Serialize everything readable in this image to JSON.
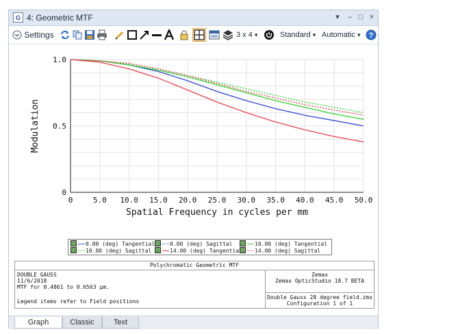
{
  "window": {
    "icon_letter": "G",
    "title": "4: Geometric MTF",
    "controls": {
      "menu": "▾",
      "minimize": "–",
      "restore": "□",
      "close": "×"
    }
  },
  "toolbar": {
    "settings_label": "Settings",
    "grid_label": "3 x 4",
    "standard_label": "Standard",
    "automatic_label": "Automatic",
    "dropdown_glyph": "▾"
  },
  "colors": {
    "blue": "#3b4fd6",
    "green": "#2fd12f",
    "red": "#e8414d",
    "accent": "#f2a33a"
  },
  "chart_data": {
    "type": "line",
    "xlabel": "Spatial Frequency in cycles per mm",
    "ylabel": "Modulation",
    "xlim": [
      0,
      50
    ],
    "ylim": [
      0,
      1.0
    ],
    "x_ticks": [
      "0",
      "5.0",
      "10.0",
      "15.0",
      "20.0",
      "25.0",
      "30.0",
      "35.0",
      "40.0",
      "45.0",
      "50.0"
    ],
    "y_ticks": [
      "0",
      "0.5",
      "1.0"
    ],
    "x": [
      0,
      5,
      10,
      15,
      20,
      25,
      30,
      35,
      40,
      45,
      50
    ],
    "series": [
      {
        "name": "0.00 (deg) Tangential",
        "color": "#3b4fd6",
        "dash": false,
        "values": [
          1.0,
          0.99,
          0.96,
          0.91,
          0.84,
          0.76,
          0.69,
          0.63,
          0.58,
          0.54,
          0.5
        ]
      },
      {
        "name": "0.00 (deg) Sagittal",
        "color": "#3b4fd6",
        "dash": true,
        "values": [
          1.0,
          0.99,
          0.96,
          0.91,
          0.84,
          0.76,
          0.69,
          0.63,
          0.58,
          0.54,
          0.5
        ]
      },
      {
        "name": "10.00 (deg) Tangential",
        "color": "#2fd12f",
        "dash": false,
        "values": [
          1.0,
          0.99,
          0.96,
          0.92,
          0.87,
          0.81,
          0.75,
          0.69,
          0.64,
          0.59,
          0.55
        ]
      },
      {
        "name": "10.00 (deg) Sagittal",
        "color": "#2fd12f",
        "dash": true,
        "values": [
          1.0,
          0.99,
          0.97,
          0.93,
          0.88,
          0.83,
          0.78,
          0.73,
          0.68,
          0.64,
          0.6
        ]
      },
      {
        "name": "14.00 (deg) Tangential",
        "color": "#e8414d",
        "dash": false,
        "values": [
          1.0,
          0.98,
          0.93,
          0.86,
          0.77,
          0.68,
          0.6,
          0.53,
          0.47,
          0.42,
          0.38
        ]
      },
      {
        "name": "14.00 (deg) Sagittal",
        "color": "#e8414d",
        "dash": true,
        "values": [
          1.0,
          0.99,
          0.97,
          0.93,
          0.88,
          0.82,
          0.76,
          0.71,
          0.66,
          0.62,
          0.58
        ]
      }
    ],
    "grid": true,
    "legend_position": "bottom"
  },
  "legend": {
    "items": [
      {
        "text": "0.00 (deg) Tangential",
        "color": "#3b4fd6",
        "dash": false
      },
      {
        "text": "0.00 (deg) Sagittal",
        "color": "#3b4fd6",
        "dash": true
      },
      {
        "text": "10.00 (deg) Tangential",
        "color": "#2fd12f",
        "dash": false
      },
      {
        "text": "10.00 (deg) Sagittal",
        "color": "#2fd12f",
        "dash": true
      },
      {
        "text": "14.00 (deg) Tangential",
        "color": "#e8414d",
        "dash": false
      },
      {
        "text": "14.00 (deg) Sagittal",
        "color": "#e8414d",
        "dash": true
      }
    ]
  },
  "info": {
    "header": "Polychromatic Geometric MTF",
    "lens_name": "DOUBLE GAUSS",
    "date": "11/6/2018",
    "wavelength": "MTF for 0.4861 to 0.6563 μm.",
    "note": "Legend items refer to Field positions",
    "company": "Zemax",
    "product": "Zemax OpticStudio 18.7  BETA",
    "file": "Double Gauss 28 degree field.zmx",
    "configuration": "Configuration 1 of 1"
  },
  "tabs": [
    {
      "label": "Graph",
      "active": true
    },
    {
      "label": "Classic",
      "active": false
    },
    {
      "label": "Text",
      "active": false
    }
  ]
}
